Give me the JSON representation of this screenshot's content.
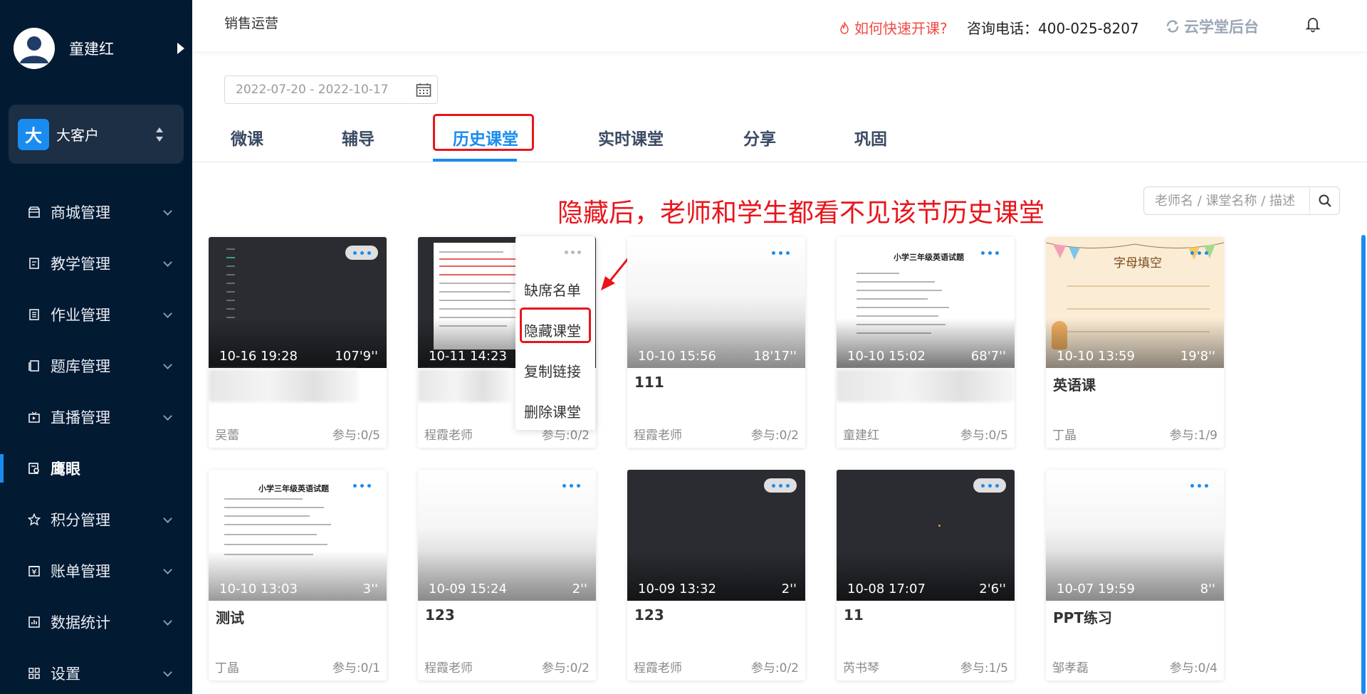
{
  "user": {
    "name": "童建红"
  },
  "org": {
    "badge": "大",
    "name": "大客户"
  },
  "menu": [
    {
      "label": "商城管理",
      "icon": "shop-icon"
    },
    {
      "label": "教学管理",
      "icon": "teaching-icon"
    },
    {
      "label": "作业管理",
      "icon": "homework-icon"
    },
    {
      "label": "题库管理",
      "icon": "question-bank-icon"
    },
    {
      "label": "直播管理",
      "icon": "live-icon"
    },
    {
      "label": "鹰眼",
      "icon": "eagle-eye-icon"
    },
    {
      "label": "积分管理",
      "icon": "points-icon"
    },
    {
      "label": "账单管理",
      "icon": "bill-icon"
    },
    {
      "label": "数据统计",
      "icon": "stats-icon"
    },
    {
      "label": "设置",
      "icon": "settings-icon"
    }
  ],
  "header": {
    "title": "销售运营",
    "help": "如何快速开课?",
    "phone": "咨询电话：400-025-8207",
    "backend": "云学堂后台"
  },
  "date_range": "2022-07-20 - 2022-10-17",
  "tabs": [
    "微课",
    "辅导",
    "历史课堂",
    "实时课堂",
    "分享",
    "巩固"
  ],
  "search": {
    "placeholder": "老师名 / 课堂名称 / 描述"
  },
  "annotation": "隐藏后，老师和学生都看不见该节历史课堂",
  "context_menu": [
    "缺席名单",
    "隐藏课堂",
    "复制链接",
    "删除课堂"
  ],
  "cards": [
    {
      "time": "10-16 19:28",
      "duration": "107'9''",
      "title": "",
      "teacher": "吴蕾",
      "count": "参与:0/5"
    },
    {
      "time": "10-11 14:23",
      "duration": "",
      "title": "",
      "teacher": "程霞老师",
      "count": "参与:0/2"
    },
    {
      "time": "10-10 15:56",
      "duration": "18'17''",
      "title": "111",
      "teacher": "程霞老师",
      "count": "参与:0/2"
    },
    {
      "time": "10-10 15:02",
      "duration": "68'7''",
      "title": "",
      "teacher": "童建红",
      "count": "参与:0/5"
    },
    {
      "time": "10-10 13:59",
      "duration": "19'8''",
      "title": "英语课",
      "teacher": "丁晶",
      "count": "参与:1/9"
    },
    {
      "time": "10-10 13:03",
      "duration": "3''",
      "title": "测试",
      "teacher": "丁晶",
      "count": "参与:0/1"
    },
    {
      "time": "10-09 15:24",
      "duration": "2''",
      "title": "123",
      "teacher": "程霞老师",
      "count": "参与:0/2"
    },
    {
      "time": "10-09 13:32",
      "duration": "2''",
      "title": "123",
      "teacher": "程霞老师",
      "count": "参与:0/2"
    },
    {
      "time": "10-08 17:07",
      "duration": "2'6''",
      "title": "11",
      "teacher": "芮书琴",
      "count": "参与:1/5"
    },
    {
      "time": "10-07 19:59",
      "duration": "8''",
      "title": "PPT练习",
      "teacher": "邹孝磊",
      "count": "参与:0/4"
    }
  ],
  "thumbnails": {
    "doc_title": "小学三年级英语试题",
    "kids_title": "字母填空"
  },
  "colors": {
    "accent": "#1a8cf0",
    "sidebar": "#031a33",
    "alert": "#e8151b"
  }
}
